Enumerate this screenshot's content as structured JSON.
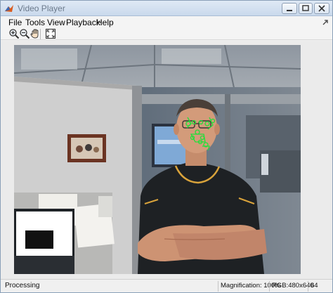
{
  "window": {
    "title": "Video Player"
  },
  "menu": {
    "items": [
      "File",
      "Tools",
      "View",
      "Playback",
      "Help"
    ]
  },
  "toolbar": {
    "tools": [
      {
        "icon": "zoom-in-icon"
      },
      {
        "icon": "zoom-out-icon"
      },
      {
        "icon": "pan-hand-icon"
      },
      {
        "icon": "fit-to-window-icon"
      }
    ]
  },
  "status": {
    "state": "Processing",
    "magnification": "Magnification: 100%",
    "format": "RGB:480x640",
    "frame": "64"
  },
  "colors": {
    "titlebar": "#c9d9ec",
    "tracker_points": "#22e03a",
    "frame_border": "#6a6f75"
  }
}
